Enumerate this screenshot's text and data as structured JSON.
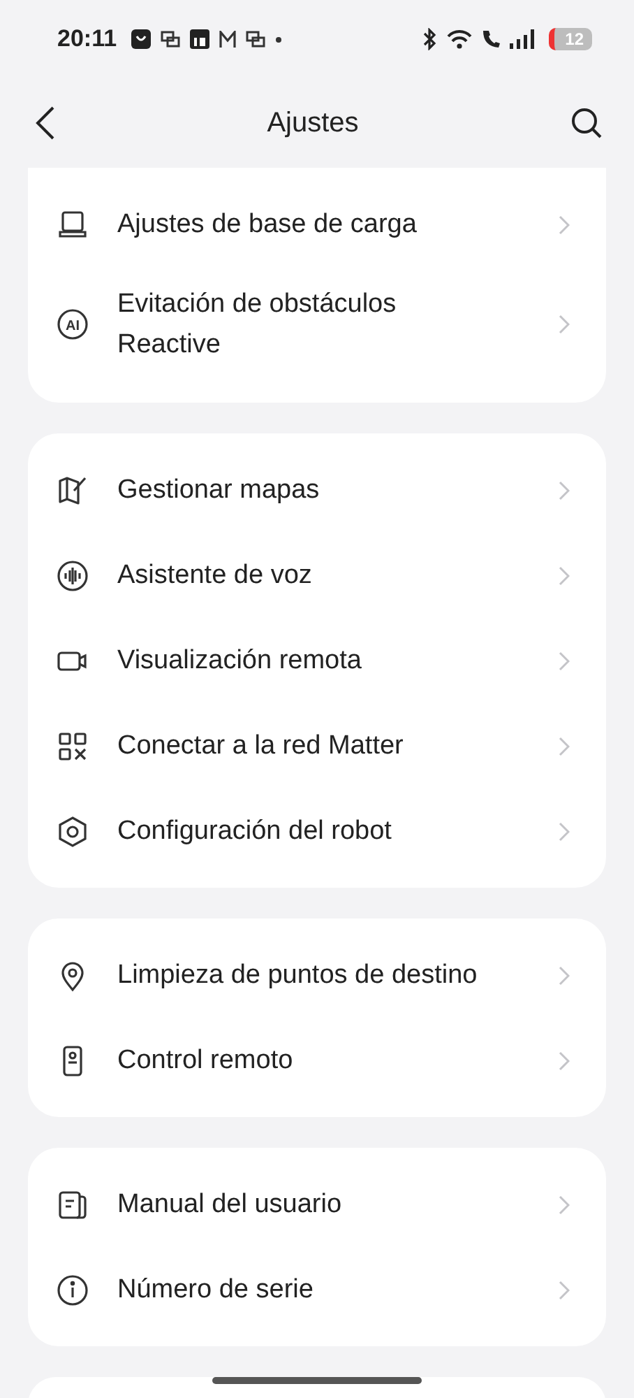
{
  "status_bar": {
    "time": "20:11",
    "battery": "12"
  },
  "header": {
    "title": "Ajustes"
  },
  "groups": [
    {
      "items": [
        {
          "label": "Ajustes de base de carga"
        },
        {
          "badge": "AI",
          "label": "Evitación de obstáculos Reactive"
        }
      ]
    },
    {
      "items": [
        {
          "label": "Gestionar mapas"
        },
        {
          "label": "Asistente de voz"
        },
        {
          "label": "Visualización remota"
        },
        {
          "label": "Conectar a la red Matter"
        },
        {
          "label": "Configuración del robot"
        }
      ]
    },
    {
      "items": [
        {
          "label": "Limpieza de puntos de destino"
        },
        {
          "label": "Control remoto"
        }
      ]
    },
    {
      "items": [
        {
          "label": "Manual del usuario"
        },
        {
          "label": "Número de serie"
        }
      ]
    }
  ]
}
